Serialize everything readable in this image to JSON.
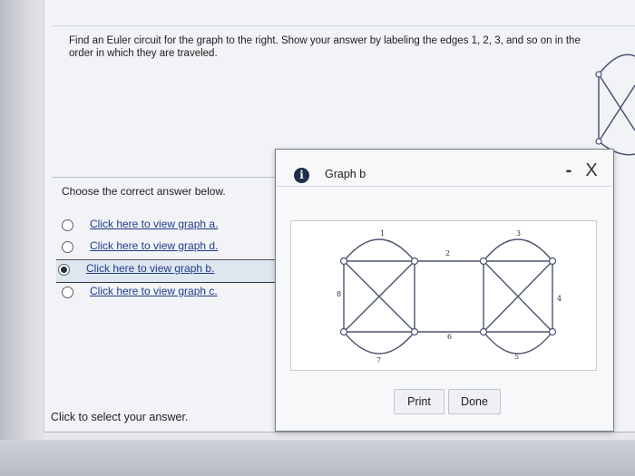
{
  "question": {
    "text": "Find an Euler circuit for the graph to the right. Show your answer by labeling the edges 1, 2, 3, and so on in the order in which they are traveled."
  },
  "choose_text": "Choose the correct answer below.",
  "options": [
    {
      "label": "Click here to view graph a.",
      "selected": false
    },
    {
      "label": "Click here to view graph d.",
      "selected": false
    },
    {
      "label": "Click here to view graph b.",
      "selected": true
    },
    {
      "label": "Click here to view graph c.",
      "selected": false
    }
  ],
  "click_hint": "Click to select your answer.",
  "dialog": {
    "title": "Graph b",
    "info_icon": "info-icon",
    "minimize_label": "-",
    "close_label": "X",
    "print_label": "Print",
    "done_label": "Done",
    "edge_labels": [
      "1",
      "2",
      "3",
      "4",
      "5",
      "6",
      "7",
      "8"
    ]
  }
}
